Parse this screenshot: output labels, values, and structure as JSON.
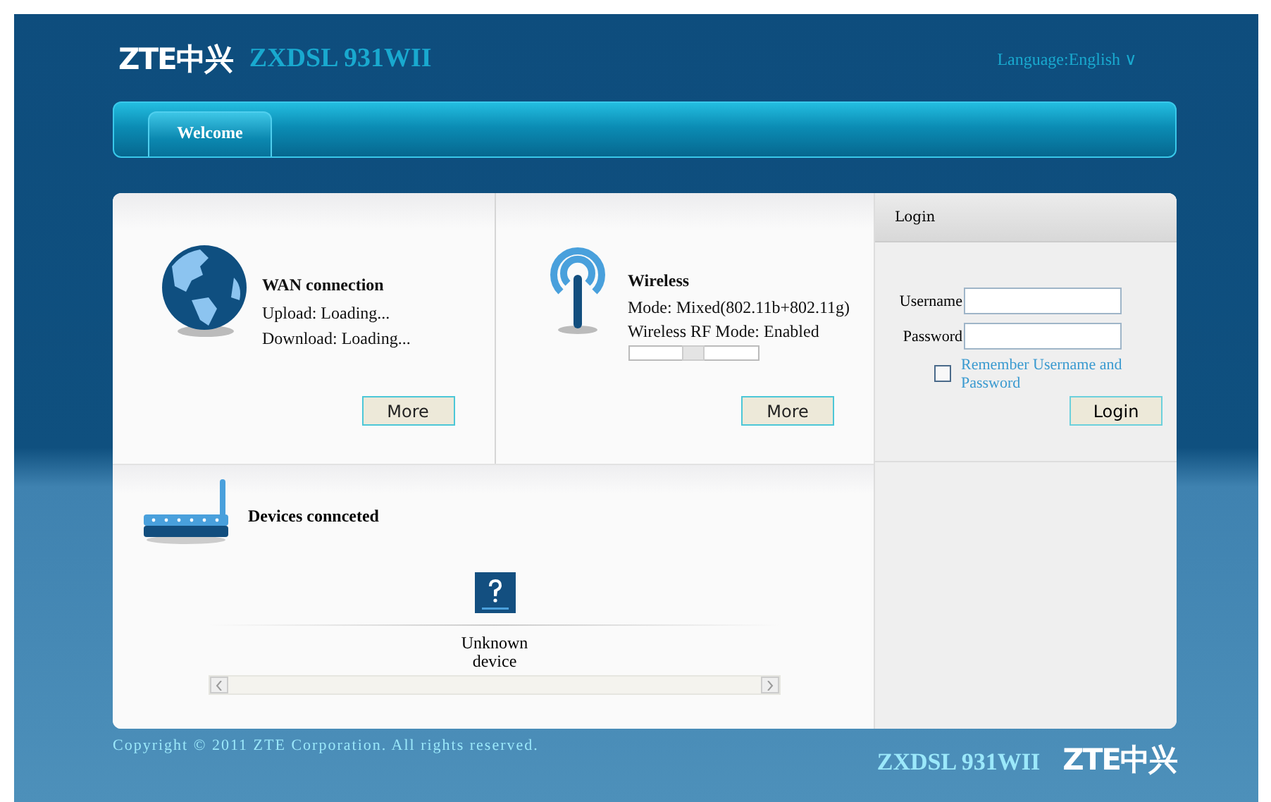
{
  "header": {
    "logo": "ZTE中兴",
    "model": "ZXDSL 931WII",
    "language": "Language:English ∨"
  },
  "tabs": [
    {
      "label": "Welcome",
      "selected": true
    }
  ],
  "wan": {
    "title": "WAN connection",
    "lines": [
      "Upload: Loading...",
      "Download: Loading..."
    ],
    "button": "More"
  },
  "wireless": {
    "title": "Wireless",
    "lines": [
      "Mode: Mixed(802.11b+802.11g)",
      "Wireless RF Mode: Enabled"
    ],
    "level": 0.5,
    "button": "More"
  },
  "devices": {
    "title": "Devices connceted",
    "items": [
      {
        "label": "Unknown device"
      }
    ]
  },
  "login": {
    "title": "Login",
    "fields": [
      {
        "label": "Username"
      },
      {
        "label": "Password"
      }
    ],
    "remember": {
      "label": "Remember Username and Password",
      "checked": false
    },
    "button": "Login"
  },
  "footer": {
    "copyright": "Copyright © 2011 ZTE Corporation. All rights reserved.",
    "model": "ZXDSL 931WII",
    "logo": "ZTE中兴"
  }
}
